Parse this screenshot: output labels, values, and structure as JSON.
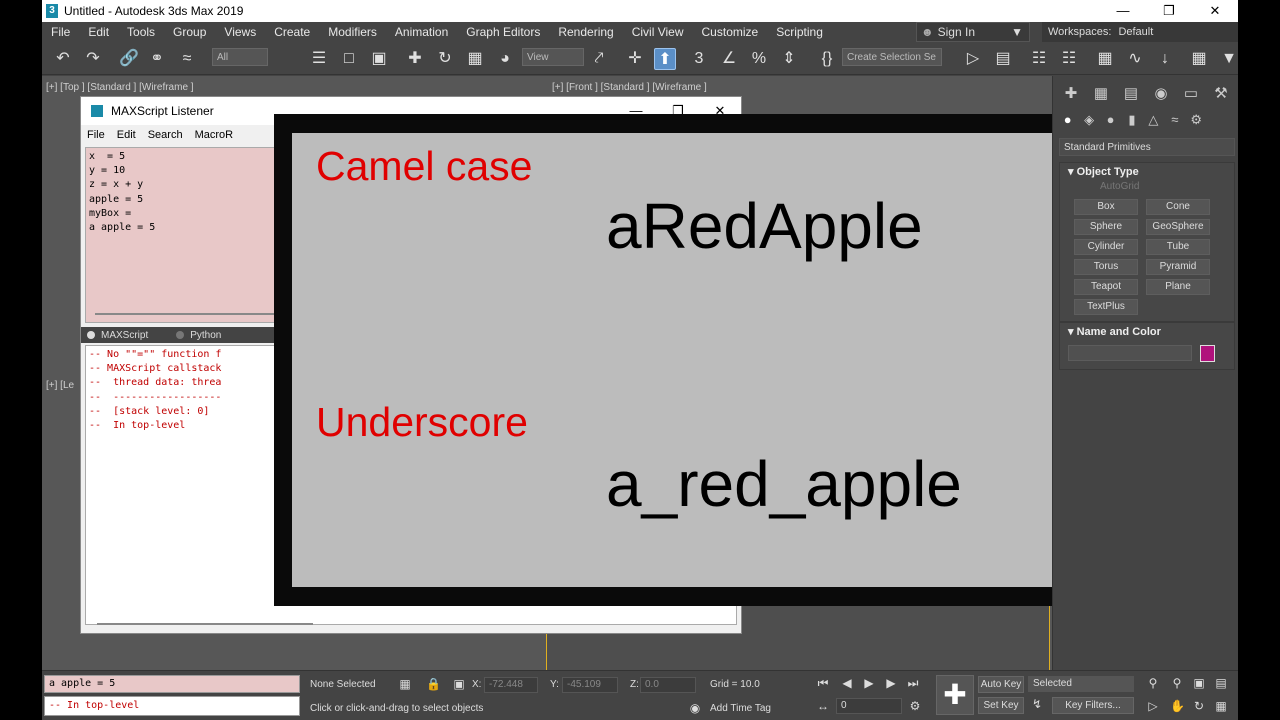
{
  "window": {
    "title": "Untitled - Autodesk 3ds Max 2019",
    "controls": [
      "—",
      "❐",
      "✕"
    ]
  },
  "menu": [
    "File",
    "Edit",
    "Tools",
    "Group",
    "Views",
    "Create",
    "Modifiers",
    "Animation",
    "Graph Editors",
    "Rendering",
    "Civil View",
    "Customize",
    "Scripting"
  ],
  "account": {
    "sign_in": "Sign In",
    "workspaces_label": "Workspaces:",
    "workspace": "Default"
  },
  "toolbar": {
    "filter": "All",
    "view": "View",
    "selection_set": "Create Selection Se"
  },
  "viewports": {
    "top_left": "[+] [Top ] [Standard ] [Wireframe ]",
    "top_right": "[+] [Front ] [Standard ] [Wireframe ]",
    "bottom_left": "[+] [Le"
  },
  "listener": {
    "title": "MAXScript Listener",
    "menu": [
      "File",
      "Edit",
      "Search",
      "MacroR"
    ],
    "code_lines": [
      "x  = 5",
      "y = 10",
      "z = x + y",
      "apple = 5",
      "myBox =",
      "a apple = 5"
    ],
    "tabs": [
      "MAXScript",
      "Python"
    ],
    "output_lines": [
      "-- No \"\"=\"\" function f",
      "-- MAXScript callstack",
      "--  thread data: threa",
      "--  ------------------",
      "--  [stack level: 0]",
      "--  In top-level"
    ]
  },
  "slide": {
    "camel_label": "Camel case",
    "camel_example": "aRedApple",
    "underscore_label": "Underscore",
    "underscore_example": "a_red_apple"
  },
  "command_panel": {
    "dropdown": "Standard Primitives",
    "object_type": "Object Type",
    "autogrid": "AutoGrid",
    "primitives": [
      "Box",
      "Cone",
      "Sphere",
      "GeoSphere",
      "Cylinder",
      "Tube",
      "Torus",
      "Pyramid",
      "Teapot",
      "Plane",
      "TextPlus"
    ],
    "name_and_color": "Name and Color",
    "color": "#b0127c"
  },
  "status": {
    "mini_input": "a apple = 5",
    "mini_output": "--  In top-level",
    "selection": "None Selected",
    "prompt": "Click or click-and-drag to select objects",
    "x_label": "X:",
    "x": "-72.448",
    "y_label": "Y:",
    "y": "-45.109",
    "z_label": "Z:",
    "z": "0.0",
    "grid": "Grid = 10.0",
    "add_time_tag": "Add Time Tag",
    "auto_key": "Auto Key",
    "selected": "Selected",
    "set_key": "Set Key",
    "key_filters": "Key Filters...",
    "frame": "0"
  }
}
